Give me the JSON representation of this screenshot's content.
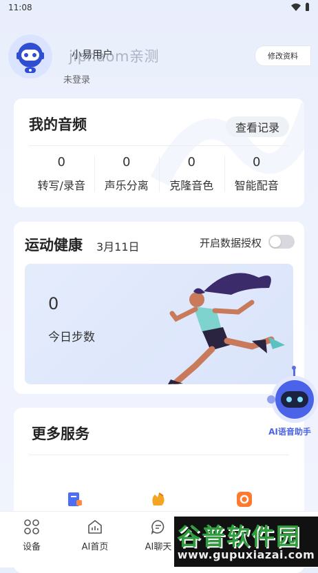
{
  "status_bar": {
    "time": "11:08"
  },
  "profile": {
    "username": "小易用户",
    "login_state": "未登录",
    "edit_button": "修改资料",
    "watermark": "jiphaom亲测"
  },
  "audio": {
    "title": "我的音频",
    "history_button": "查看记录",
    "stats": [
      {
        "value": "0",
        "label": "转写/录音"
      },
      {
        "value": "0",
        "label": "声乐分离"
      },
      {
        "value": "0",
        "label": "克隆音色"
      },
      {
        "value": "0",
        "label": "智能配音"
      }
    ]
  },
  "health": {
    "title": "运动健康",
    "date": "3月11日",
    "auth_label": "开启数据授权",
    "auth_enabled": false,
    "steps_value": "0",
    "steps_label": "今日步数"
  },
  "more_services": {
    "title": "更多服务"
  },
  "ai_assistant": {
    "label": "AI语音助手"
  },
  "tabs": [
    {
      "label": "设备",
      "icon": "device-grid-icon"
    },
    {
      "label": "AI首页",
      "icon": "home-chart-icon"
    },
    {
      "label": "AI聊天",
      "icon": "chat-icon"
    }
  ],
  "brand_overlay": {
    "name": "谷普软件园",
    "url": "www.gupuxiazai.com"
  },
  "colors": {
    "accent": "#4a63e8",
    "brand_green": "#2f9c3d",
    "toggle_off": "#d7d9de"
  }
}
